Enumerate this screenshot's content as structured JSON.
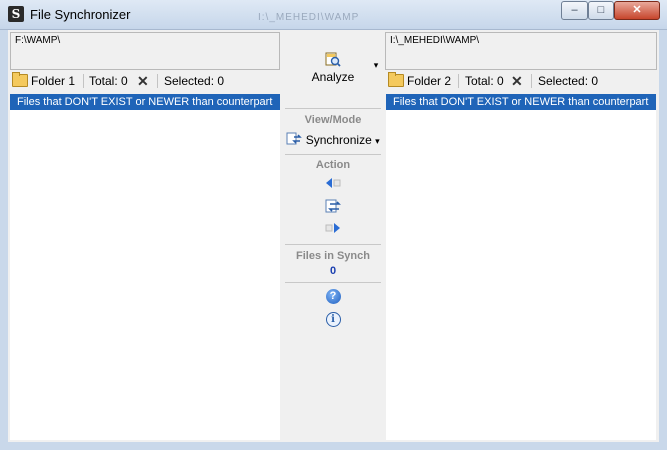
{
  "window": {
    "title": "File Synchronizer",
    "ghost_title": "I:\\_MEHEDI\\WAMP",
    "controls": {
      "minimize": "–",
      "maximize": "□",
      "close": "✕"
    }
  },
  "left_panel": {
    "path": "F:\\WAMP\\",
    "folder_label": "Folder 1",
    "total_label": "Total: 0",
    "clear_symbol": "✕",
    "selected_label": "Selected: 0",
    "filter_text": "Files that DON'T EXIST or NEWER than counterpart"
  },
  "right_panel": {
    "path": "I:\\_MEHEDI\\WAMP\\",
    "folder_label": "Folder 2",
    "total_label": "Total: 0",
    "clear_symbol": "✕",
    "selected_label": "Selected: 0",
    "filter_text": "Files that DON'T EXIST or NEWER than counterpart"
  },
  "center": {
    "analyze_label": "Analyze",
    "analyze_dropdown": "▾",
    "view_mode_header": "View/Mode",
    "view_mode_value": "Synchronize",
    "view_mode_dropdown": "▾",
    "action_header": "Action",
    "files_in_synch_header": "Files in Synch",
    "files_in_synch_count": "0"
  },
  "icons": {
    "app": "S",
    "help": "?",
    "info": "i"
  },
  "colors": {
    "selection_bar": "#1f64b8",
    "count_text": "#1a3fb0"
  }
}
